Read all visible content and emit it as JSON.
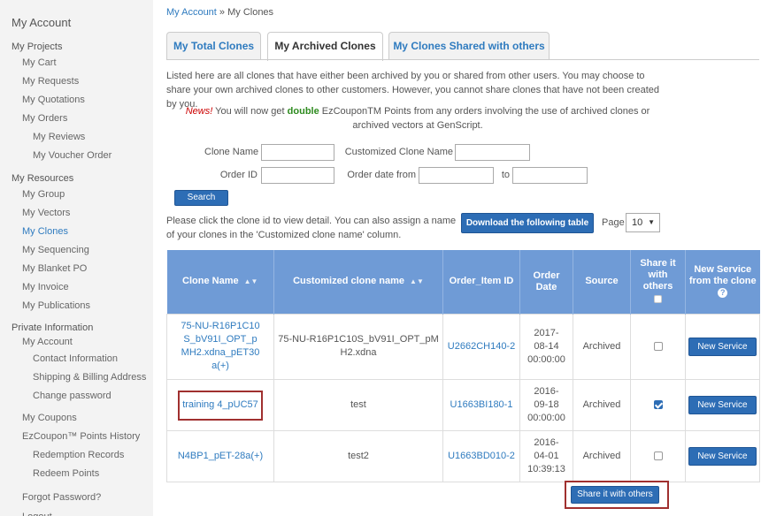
{
  "sidebar": {
    "title": "My Account",
    "projects_label": "My Projects",
    "projects": [
      "My Cart",
      "My Requests",
      "My Quotations",
      "My Orders"
    ],
    "orders_sub": [
      "My Reviews",
      "My Voucher Order"
    ],
    "resources_label": "My Resources",
    "resources": [
      "My Group",
      "My Vectors",
      "My Clones",
      "My Sequencing",
      "My Blanket PO",
      "My Invoice",
      "My Publications"
    ],
    "private_label": "Private Information",
    "account_item": "My Account",
    "account_sub": [
      "Contact Information",
      "Shipping & Billing Address",
      "Change password"
    ],
    "coupons": "My Coupons",
    "points_history": "EzCoupon™ Points History",
    "points_sub": [
      "Redemption Records",
      "Redeem Points"
    ],
    "forgot": "Forgot Password?",
    "logout": "Logout"
  },
  "breadcrumb": {
    "link": "My Account",
    "sep": " » ",
    "current": "My Clones"
  },
  "tabs": [
    "My Total Clones",
    "My Archived Clones",
    "My Clones Shared with others"
  ],
  "intro": "Listed here are all clones that have either been archived by you or shared from other users. You may choose to share your own archived clones to other customers. However, you cannot share clones that have not been created by you.",
  "news": {
    "new_label": "News!",
    "text1": " You will now get ",
    "double": "double",
    "text2": " EzCouponTM Points from any orders involving the use of archived clones or archived vectors at GenScript."
  },
  "filters": {
    "clone_name": "Clone Name",
    "customized_clone_name": "Customized Clone Name",
    "order_id": "Order ID",
    "order_date_from": "Order date from",
    "to": "to"
  },
  "search_label": "Search",
  "hint": "Please click the clone id to view detail. You can also assign a name of your clones in the 'Customized clone name' column.",
  "download_label": "Download the following table",
  "page": {
    "label": "Page",
    "value": "10"
  },
  "table": {
    "headers": {
      "clone_name": "Clone Name",
      "customized": "Customized clone name",
      "order_item": "Order_Item ID",
      "order_date": "Order Date",
      "source": "Source",
      "share": "Share it with others",
      "new_service": "New Service from the clone"
    },
    "rows": [
      {
        "clone": "75-NU-R16P1C10S_bV91I_OPT_pMH2.xdna_pET30a(+)",
        "customized": "75-NU-R16P1C10S_bV91I_OPT_pMH2.xdna",
        "order_item": "U2662CH140-2",
        "date": "2017-08-14",
        "time": "00:00:00",
        "source": "Archived",
        "shared": false,
        "service": "New Service"
      },
      {
        "clone": "training 4_pUC57",
        "customized": "test",
        "order_item": "U1663BI180-1",
        "date": "2016-09-18",
        "time": "00:00:00",
        "source": "Archived",
        "shared": true,
        "service": "New Service"
      },
      {
        "clone": "N4BP1_pET-28a(+)",
        "customized": "test2",
        "order_item": "U1663BD010-2",
        "date": "2016-04-01",
        "time": "10:39:13",
        "source": "Archived",
        "shared": false,
        "service": "New Service"
      }
    ]
  },
  "share_label": "Share it with others",
  "colors": {
    "link": "#2f7bbf",
    "header_bg": "#6f9bd6",
    "button": "#2d6db5",
    "highlight": "#a0302f",
    "news": "#cc0000",
    "double": "#2e8b1f"
  }
}
